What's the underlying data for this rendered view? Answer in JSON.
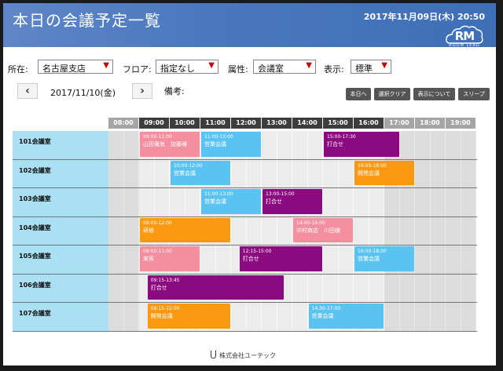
{
  "header": {
    "title": "本日の会議予定一覧",
    "datetime": "2017年11月09日(木) 20:50",
    "logo_text": "RM",
    "logo_sub": "ROOM LEAD"
  },
  "filters": {
    "location_label": "所在:",
    "location_value": "名古屋支店",
    "floor_label": "フロア:",
    "floor_value": "指定なし",
    "attribute_label": "属性:",
    "attribute_value": "会議室",
    "display_label": "表示:",
    "display_value": "標準"
  },
  "datebar": {
    "prev_icon": "chevron-left-icon",
    "date": "2017/11/10(金)",
    "next_icon": "chevron-right-icon",
    "note_label": "備考:"
  },
  "toolbar": {
    "today": "本日へ",
    "clear": "選択クリア",
    "about": "表示について",
    "sleep": "スリープ"
  },
  "hours": [
    "08:00",
    "09:00",
    "10:00",
    "11:00",
    "12:00",
    "13:00",
    "14:00",
    "15:00",
    "16:00",
    "17:00",
    "18:00",
    "19:00"
  ],
  "colors": {
    "pink": "#f38f9f",
    "blue": "#5bc3f2",
    "purple": "#8c0a7f",
    "orange": "#fb9a11",
    "room_bg": "#a9e0f3",
    "header_active": "#3d3d3d",
    "header_inactive": "#a5a5a5"
  },
  "rooms": [
    {
      "name": "101会議室",
      "events": [
        {
          "time": "09:00-11:00",
          "title": "山田電気　加藤様",
          "color": "pink"
        },
        {
          "time": "11:00-13:00",
          "title": "営業会議",
          "color": "blue"
        },
        {
          "time": "15:00-17:30",
          "title": "打合せ",
          "color": "purple"
        }
      ]
    },
    {
      "name": "102会議室",
      "events": [
        {
          "time": "10:00-12:00",
          "title": "営業会議",
          "color": "blue"
        },
        {
          "time": "16:00-18:00",
          "title": "開発会議",
          "color": "orange"
        }
      ]
    },
    {
      "name": "103会議室",
      "events": [
        {
          "time": "11:00-13:00",
          "title": "営業会議",
          "color": "blue"
        },
        {
          "time": "13:00-15:00",
          "title": "打合せ",
          "color": "purple"
        }
      ]
    },
    {
      "name": "104会議室",
      "events": [
        {
          "time": "09:00-12:00",
          "title": "研修",
          "color": "orange"
        },
        {
          "time": "14:00-16:00",
          "title": "中村商店　川田様",
          "color": "pink"
        }
      ]
    },
    {
      "name": "105会議室",
      "events": [
        {
          "time": "09:00-11:00",
          "title": "来客",
          "color": "pink"
        },
        {
          "time": "12:15-15:00",
          "title": "打合せ",
          "color": "purple"
        },
        {
          "time": "16:00-18:00",
          "title": "営業会議",
          "color": "blue"
        }
      ]
    },
    {
      "name": "106会議室",
      "events": [
        {
          "time": "09:15-13:45",
          "title": "打合せ",
          "color": "purple"
        }
      ]
    },
    {
      "name": "107会議室",
      "events": [
        {
          "time": "09:15-12:00",
          "title": "開発会議",
          "color": "orange"
        },
        {
          "time": "14:30-17:00",
          "title": "営業会議",
          "color": "blue"
        }
      ]
    }
  ],
  "footer": {
    "company": "株式会社ユーテック"
  }
}
